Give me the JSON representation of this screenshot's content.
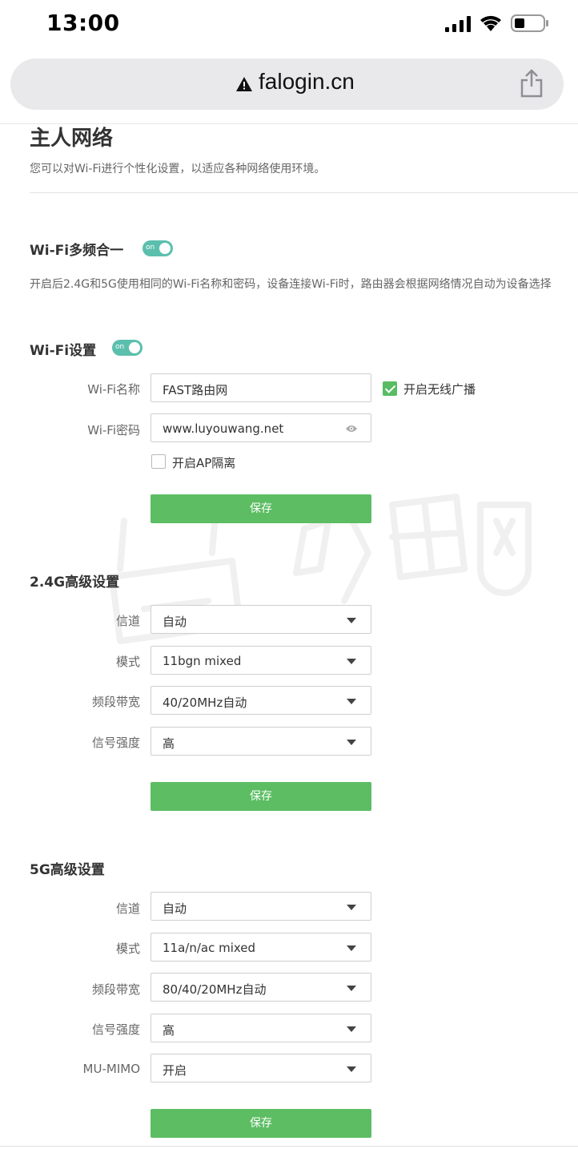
{
  "status_bar": {
    "time": "13:00"
  },
  "browser": {
    "url": "falogin.cn"
  },
  "page": {
    "title": "主人网络",
    "description": "您可以对Wi-Fi进行个性化设置，以适应各种网络使用环境。"
  },
  "multiband": {
    "title": "Wi-Fi多频合一",
    "toggle": "on",
    "description": "开启后2.4G和5G使用相同的Wi-Fi名称和密码，设备连接Wi-Fi时，路由器会根据网络情况自动为设备选择"
  },
  "wifi_settings": {
    "title": "Wi-Fi设置",
    "toggle": "on",
    "name_label": "Wi-Fi名称",
    "name_value": "FAST路由网",
    "broadcast_label": "开启无线广播",
    "broadcast_checked": true,
    "password_label": "Wi-Fi密码",
    "password_value": "www.luyouwang.net",
    "ap_isolation_label": "开启AP隔离",
    "ap_isolation_checked": false,
    "save_label": "保存"
  },
  "band24": {
    "title": "2.4G高级设置",
    "channel_label": "信道",
    "channel_value": "自动",
    "mode_label": "模式",
    "mode_value": "11bgn mixed",
    "bandwidth_label": "频段带宽",
    "bandwidth_value": "40/20MHz自动",
    "power_label": "信号强度",
    "power_value": "高",
    "save_label": "保存"
  },
  "band5": {
    "title": "5G高级设置",
    "channel_label": "信道",
    "channel_value": "自动",
    "mode_label": "模式",
    "mode_value": "11a/n/ac mixed",
    "bandwidth_label": "频段带宽",
    "bandwidth_value": "80/40/20MHz自动",
    "power_label": "信号强度",
    "power_value": "高",
    "mumimo_label": "MU-MIMO",
    "mumimo_value": "开启",
    "save_label": "保存"
  },
  "colors": {
    "accent_green": "#5cbd63",
    "toggle_teal": "#5cbfae"
  }
}
